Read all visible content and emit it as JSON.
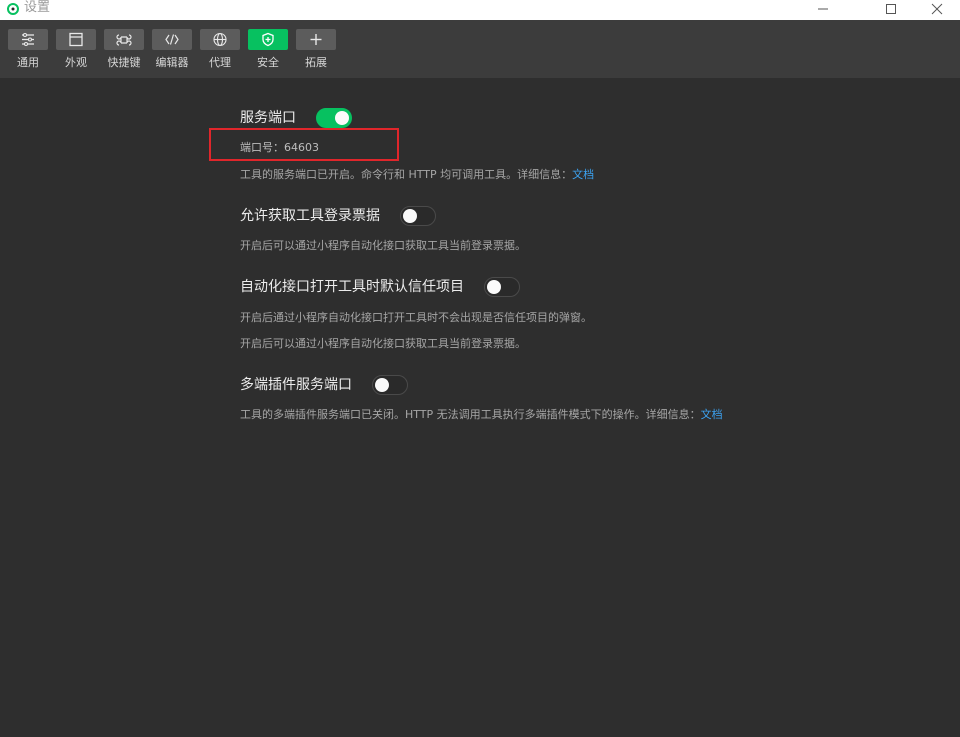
{
  "window": {
    "title": "设置",
    "colors": {
      "titlebar": "#ffffff",
      "toolbar": "#3c3c3c",
      "background": "#2e2e2e",
      "accent": "#07c160",
      "link": "#3ca3f2",
      "highlight_border": "#e0262b"
    }
  },
  "toolbar": {
    "items": [
      {
        "label": "通用",
        "icon": "sliders-icon"
      },
      {
        "label": "外观",
        "icon": "layout-icon"
      },
      {
        "label": "快捷键",
        "icon": "command-icon"
      },
      {
        "label": "编辑器",
        "icon": "code-icon"
      },
      {
        "label": "代理",
        "icon": "globe-icon"
      },
      {
        "label": "安全",
        "icon": "shield-icon",
        "active": true
      },
      {
        "label": "拓展",
        "icon": "plus-icon"
      }
    ]
  },
  "settings": {
    "service_port": {
      "title": "服务端口",
      "enabled": true,
      "port_label": "端口号：",
      "port_value": "64603",
      "desc": "工具的服务端口已开启。命令行和 HTTP 均可调用工具。详细信息：",
      "link": "文档"
    },
    "login_ticket": {
      "title": "允许获取工具登录票据",
      "enabled": false,
      "desc": "开启后可以通过小程序自动化接口获取工具当前登录票据。"
    },
    "trust_project": {
      "title": "自动化接口打开工具时默认信任项目",
      "enabled": false,
      "desc1": "开启后通过小程序自动化接口打开工具时不会出现是否信任项目的弹窗。",
      "desc2": "开启后可以通过小程序自动化接口获取工具当前登录票据。"
    },
    "multi_plugin": {
      "title": "多端插件服务端口",
      "enabled": false,
      "desc": "工具的多端插件服务端口已关闭。HTTP 无法调用工具执行多端插件模式下的操作。详细信息：",
      "link": "文档"
    }
  }
}
